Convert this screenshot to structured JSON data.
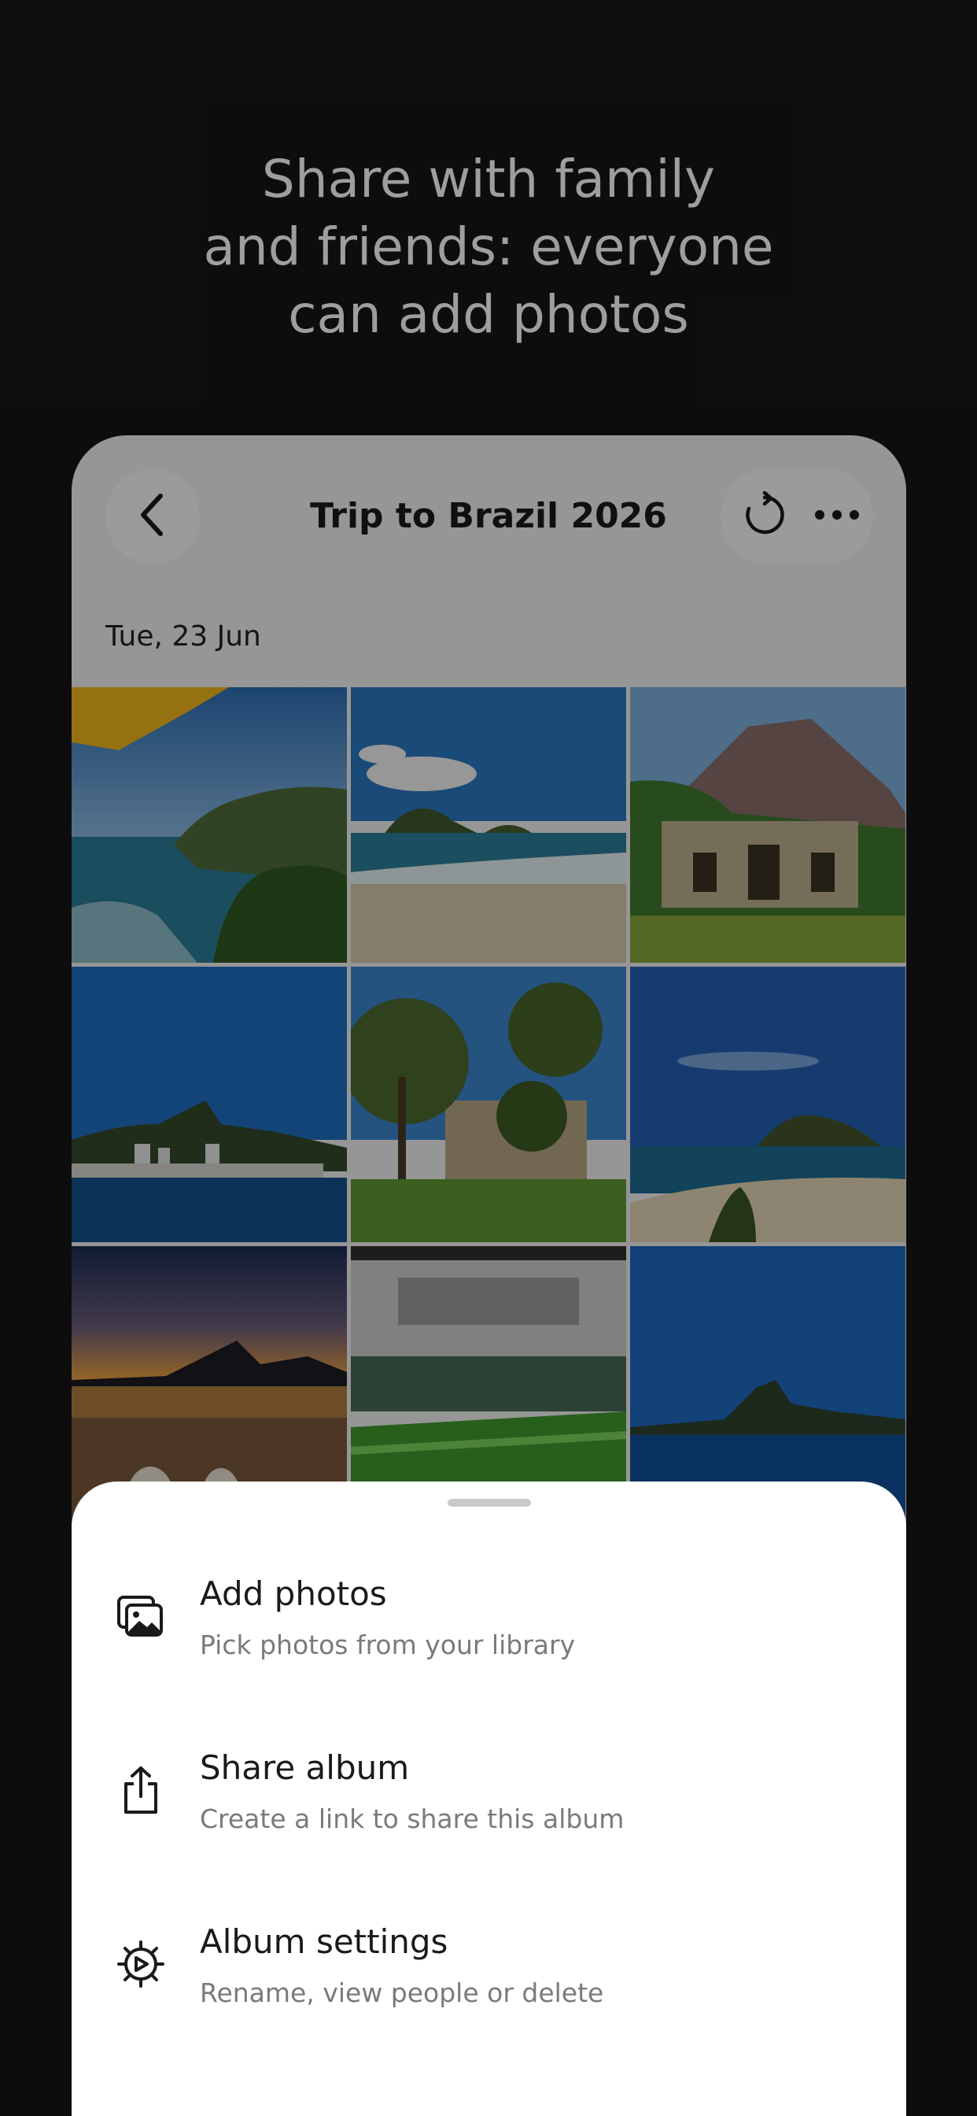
{
  "headline": {
    "line1": "Share with family",
    "line2": "and friends: everyone",
    "line3": "can add photos"
  },
  "album": {
    "title": "Trip to Brazil 2026",
    "date_label": "Tue, 23 Jun",
    "photos": [
      "beach-umbrella-coast",
      "sandy-beach-islands",
      "mountain-mansion",
      "city-skyline-mountain",
      "garden-house-trees",
      "island-beach",
      "sunset-lagoon",
      "stadium",
      "sugarloaf-bay"
    ]
  },
  "icons": {
    "back": "chevron-left-icon",
    "refresh": "refresh-icon",
    "more": "more-horizontal-icon"
  },
  "sheet": {
    "items": [
      {
        "icon": "photos-icon",
        "title": "Add photos",
        "subtitle": "Pick photos from your library"
      },
      {
        "icon": "share-icon",
        "title": "Share album",
        "subtitle": "Create a link to share this album"
      },
      {
        "icon": "gear-icon",
        "title": "Album settings",
        "subtitle": "Rename, view people or delete"
      }
    ]
  },
  "colors": {
    "background": "#161616",
    "sheet": "#ffffff",
    "accent_text": "#1a1a1a",
    "secondary_text": "#7a7a7a"
  }
}
